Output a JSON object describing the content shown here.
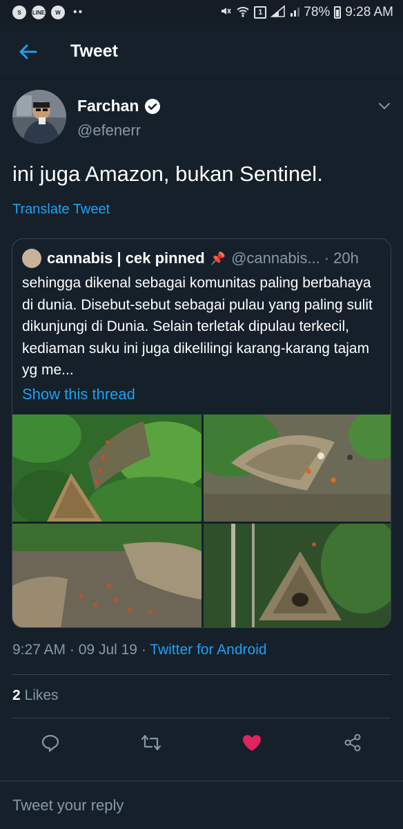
{
  "status_bar": {
    "app_icons": [
      "snapchat-icon",
      "line-icon",
      "whatsapp-icon"
    ],
    "app_icon_labels": [
      "S",
      "LINE",
      "W"
    ],
    "more_indicator": "••",
    "sim_badge": "1",
    "battery": "78%",
    "time": "9:28 AM"
  },
  "header": {
    "title": "Tweet"
  },
  "tweet": {
    "author_name": "Farchan",
    "author_handle": "@efenerr",
    "text": "ini juga Amazon, bukan Sentinel.",
    "translate_label": "Translate Tweet",
    "quoted": {
      "author_name": "cannabis | cek pinned",
      "pin": "📌",
      "handle": "@cannabis...",
      "separator": "·",
      "time": "20h",
      "text": "sehingga dikenal sebagai komunitas paling berbahaya di dunia. Disebut-sebut sebagai pulau yang paling sulit dikunjungi di Dunia. Selain terletak dipulau terkecil, kediaman suku ini juga dikelilingi karang-karang tajam yg me...",
      "show_thread": "Show this thread"
    },
    "timestamp": "9:27 AM",
    "date": "09 Jul 19",
    "separator": "·",
    "source": "Twitter for Android",
    "likes_count": "2",
    "likes_label": "Likes"
  },
  "reply": {
    "placeholder": "Tweet your reply"
  },
  "colors": {
    "background": "#15202b",
    "accent": "#1da1f2",
    "secondary_text": "#8899a6",
    "like": "#e0245e",
    "border": "#38444d"
  }
}
